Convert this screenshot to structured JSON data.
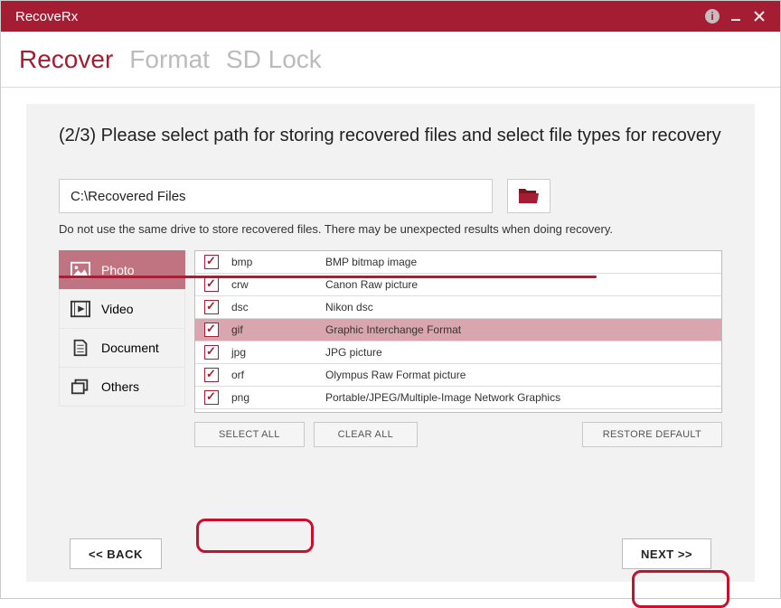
{
  "titlebar": {
    "title": "RecoveRx"
  },
  "nav": {
    "recover": "Recover",
    "format": "Format",
    "sdlock": "SD Lock"
  },
  "instruction": "(2/3) Please select path for storing recovered files and select file types for recovery",
  "path": {
    "value": "C:\\Recovered Files"
  },
  "note": "Do not use the same drive to store recovered files. There may be unexpected results when doing recovery.",
  "categories": [
    {
      "label": "Photo",
      "active": true
    },
    {
      "label": "Video",
      "active": false
    },
    {
      "label": "Document",
      "active": false
    },
    {
      "label": "Others",
      "active": false
    }
  ],
  "filetypes": [
    {
      "ext": "bmp",
      "desc": "BMP bitmap image",
      "checked": true
    },
    {
      "ext": "crw",
      "desc": "Canon Raw picture",
      "checked": true
    },
    {
      "ext": "dsc",
      "desc": "Nikon dsc",
      "checked": true
    },
    {
      "ext": "gif",
      "desc": "Graphic Interchange Format",
      "checked": true,
      "highlight": true
    },
    {
      "ext": "jpg",
      "desc": "JPG picture",
      "checked": true
    },
    {
      "ext": "orf",
      "desc": "Olympus Raw Format picture",
      "checked": true
    },
    {
      "ext": "png",
      "desc": "Portable/JPEG/Multiple-Image Network Graphics",
      "checked": true
    }
  ],
  "buttons": {
    "select_all": "SELECT ALL",
    "clear_all": "CLEAR ALL",
    "restore_default": "RESTORE DEFAULT",
    "back": "<<  BACK",
    "next": "NEXT  >>"
  }
}
